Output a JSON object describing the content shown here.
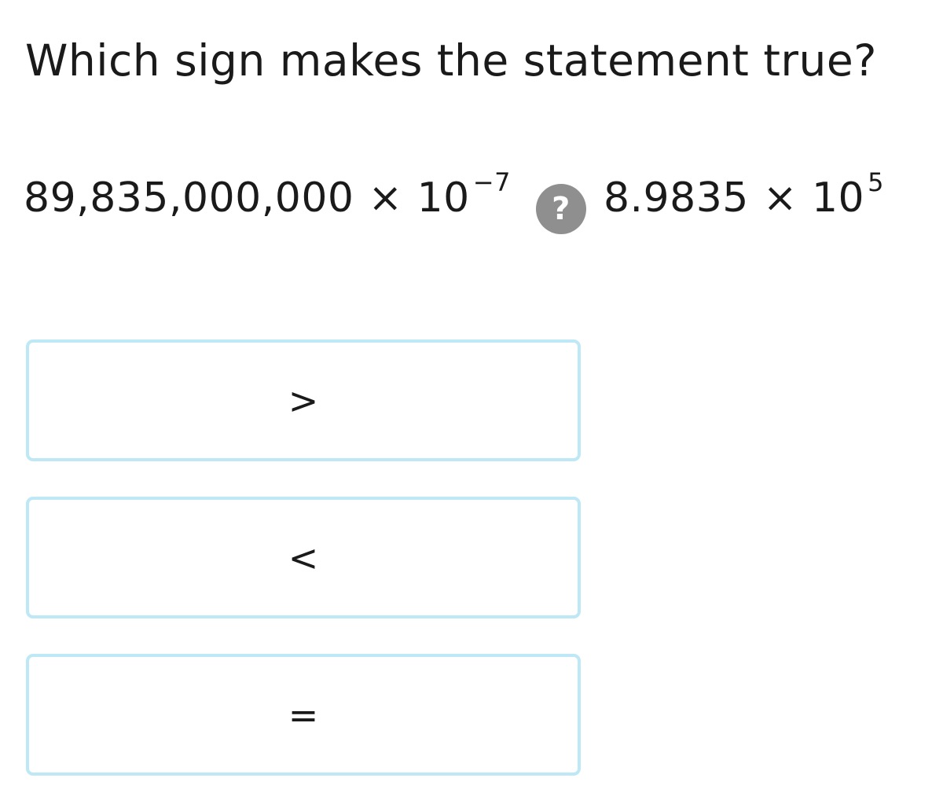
{
  "question": "Which sign makes the statement true?",
  "statement": {
    "left_base": "89,835,000,000",
    "left_times": "×",
    "left_power_base": "10",
    "left_exponent": "−7",
    "unknown_symbol": "?",
    "right_base": "8.9835",
    "right_times": "×",
    "right_power_base": "10",
    "right_exponent": "5"
  },
  "choices": [
    {
      "label": ">"
    },
    {
      "label": "<"
    },
    {
      "label": "="
    }
  ],
  "colors": {
    "choice_border": "#bfe8f7",
    "unknown_badge": "#8f8f8f"
  }
}
